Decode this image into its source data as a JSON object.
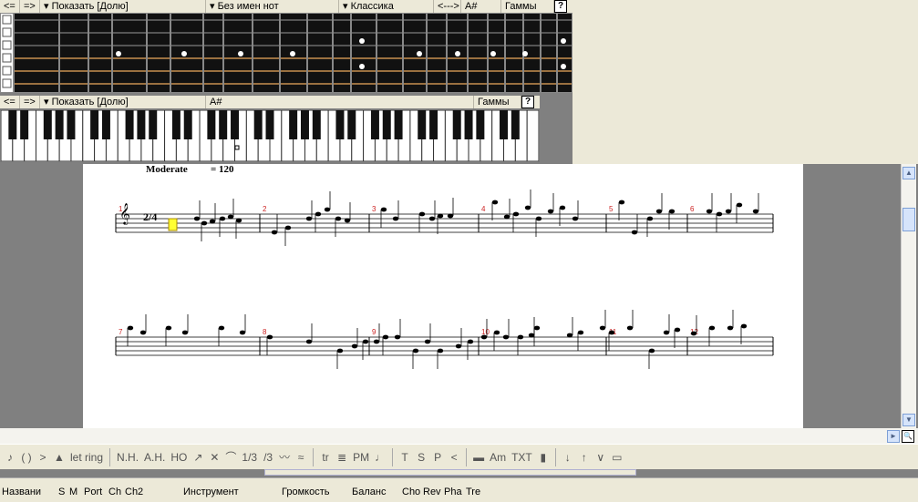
{
  "fretboard_bar": {
    "items": [
      "<=",
      "=>",
      "▾ Показать [Долю]",
      "▾ Без имен нот",
      "▾ Классика",
      "<--->",
      "A#",
      "Гаммы",
      "?"
    ]
  },
  "piano_bar": {
    "items": [
      "<=",
      "=>",
      "▾ Показать [Долю]",
      "A#",
      "Гаммы",
      "?"
    ]
  },
  "score": {
    "tempo_label": "Moderate",
    "tempo_value": "= 120",
    "time_signature": "2/4",
    "measure_numbers_row1": [
      "1",
      "2",
      "3",
      "4",
      "5",
      "6"
    ],
    "measure_numbers_row2": [
      "7",
      "8",
      "9",
      "10",
      "11",
      "12"
    ]
  },
  "toolbar": {
    "items": [
      "♪",
      "( )",
      ">",
      "▲",
      "let ring",
      "N.H.",
      "A.H.",
      "HO",
      "↗",
      "✕",
      "⌒",
      "1/3",
      "/3",
      "〰",
      "≈",
      "tr",
      "≣",
      "PM",
      "♩",
      "T",
      "S",
      "P",
      "<",
      "▬",
      "Am",
      "TXT",
      "▮",
      "↓",
      "↑",
      "∨",
      "▭"
    ]
  },
  "columns": {
    "labels": [
      "Названи",
      "S",
      "M",
      "Port",
      "Ch",
      "Ch2",
      "Инструмент",
      "Громкость",
      "Баланс",
      "Cho",
      "Rev",
      "Pha",
      "Tre"
    ]
  },
  "colors": {
    "accent": "#d0d0ff",
    "measure_number": "#cc2222",
    "fret_marker": "#ffffff"
  }
}
